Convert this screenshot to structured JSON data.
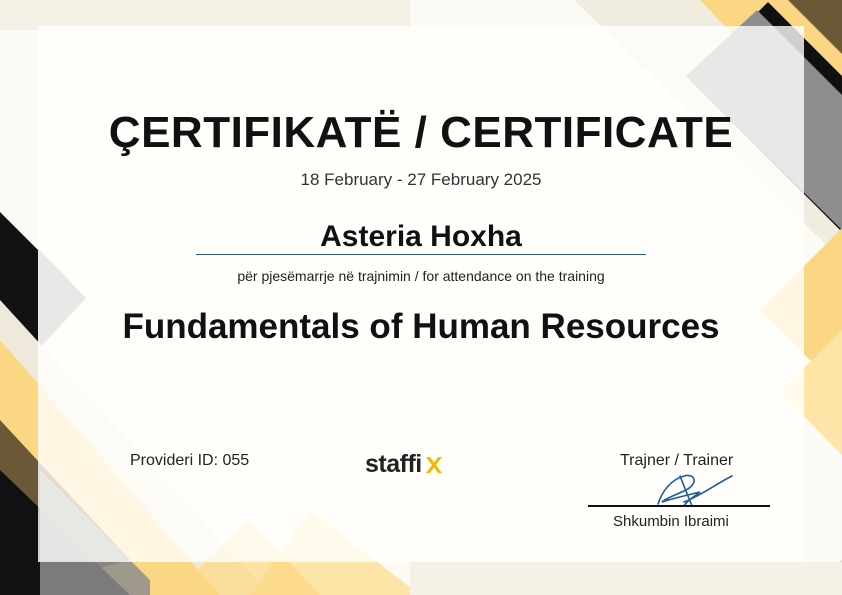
{
  "certificate": {
    "title": "ÇERTIFIKATË / CERTIFICATE",
    "dates": "18 February - 27 February 2025",
    "recipient_name": "Asteria Hoxha",
    "attendance_text": "për pjesëmarrje në trajnimin / for attendance on the training",
    "course_title": "Fundamentals of Human Resources",
    "provider_id": "Provideri ID: 055",
    "logo_text": "staffi",
    "trainer_label": "Trajner / Trainer",
    "trainer_name": "Shkumbin Ibraimi"
  },
  "colors": {
    "black": "#111111",
    "gray": "#8e8e8e",
    "gold": "#fcd783",
    "dark_gold": "#6b5836",
    "name_underline": "#2a5b8f",
    "logo_accent": "#f5b800"
  }
}
